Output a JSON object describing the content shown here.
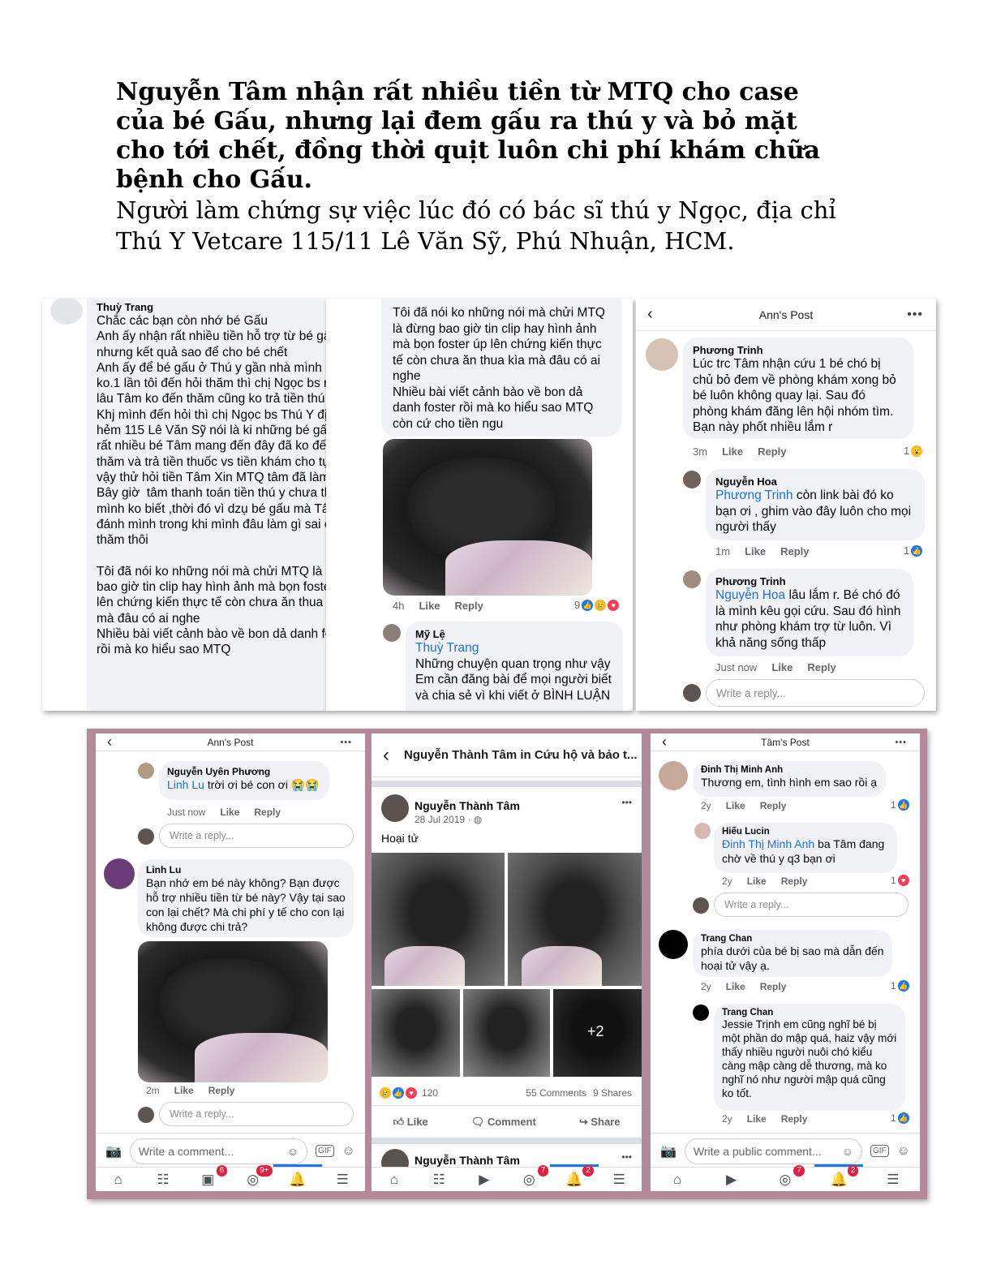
{
  "heading": "Nguyễn Tâm nhận rất nhiều tiền từ MTQ cho case của bé Gấu, nhưng lại đem gấu ra thú y và bỏ mặt cho tới chết, đồng thời quịt luôn chi phí khám chữa bệnh cho Gấu.",
  "subheading": "Người làm chứng sự việc lúc đó có bác sĩ thú y Ngọc, địa chỉ Thú Y Vetcare 115/11 Lê Văn Sỹ, Phú Nhuận, HCM.",
  "shot1": {
    "name": "Thuỳ Trang",
    "text": "Chắc các bạn còn nhớ bé Gấu\nAnh ấy nhận rất nhiều tiền hỗ trợ từ bé gấu nhưng kết quả sao để cho bé chết\nAnh ấy để bé gấu ở Thú y gần nhà mình rất lâu ko.1 lần tôi đến hỏi thăm thì chị Ngọc bs nói  từ lâu Tâm ko đến thăm cũng ko trả tiền thú y\nKhj mình đến hỏi thì chị Ngọc bs Thú Y địa chỉ hẻm 115 Lê Văn Sỹ nói là ki những bé gấu và rất nhiều bé Tâm mang đến đây đã ko đến thăm và trả tiền thuốc vs tiền khám cho tụi nhỏ vậy thử hỏi tiền Tâm Xin MTQ tâm đã làm  gì\nBây giờ  tâm thanh toán tiền thú y chưa thì mình ko biết ,thời đó vì dzụ bé gấu mà Tâm đòi đánh mình trong khi mình đâu làm gì sai chỉ hỏi thăm thôi\n\nTôi đã nói ko những nói mà chửi MTQ là đừng bao giờ tin clip hay hình ảnh mà bọn foster úp lên chứng kiến thực tế còn chưa ăn thua kìa mà đâu có ai nghe\nNhiều bài viết cảnh bào về bon dả danh foster rồi mà ko hiểu sao MTQ"
  },
  "shot2": {
    "text": "Tôi đã nói ko những nói mà chửi MTQ là đừng bao giờ tin clip hay hình ảnh mà bọn foster úp lên chứng kiến thực tế còn chưa ăn thua kìa mà đâu có ai nghe\nNhiều bài viết cảnh bào về bon dả danh foster rồi mà ko hiểu sao MTQ còn cứ cho tiền ngu",
    "time": "4h",
    "like": "Like",
    "reply": "Reply",
    "reactions": "9",
    "reply_name": "Mỹ Lệ",
    "reply_mention": "Thuỳ Trang",
    "reply_text": "Những chuyện quan trọng như vậy Em cần đăng bài để mọi người biết và chia sẻ vì khi viết ở BÌNH LUẬN"
  },
  "shot3": {
    "title": "Ann's Post",
    "c1": {
      "name": "Phương Trinh",
      "text": "Lúc trc Tâm nhận cứu 1 bé chó bị chủ bỏ đem về phòng khám xong bỏ bé luôn không quay lại. Sau đó phòng khám đăng lên hội nhóm tìm. Bạn này phốt nhiều lắm r",
      "time": "3m",
      "count": "1"
    },
    "c2": {
      "name": "Nguyễn Hoa",
      "mention": "Phương Trinh",
      "text": " còn link bài đó ko bạn ơi , ghim vào đây luôn cho mọi người thấy",
      "time": "1m",
      "count": "1"
    },
    "c3": {
      "name": "Phương Trinh",
      "mention": "Nguyễn Hoa",
      "text": " lâu lắm r. Bé chó đó là mình kêu gọi cứu. Sau đó hình như phòng khám trợ từ luôn. Vì khả năng sống thấp",
      "time": "Just now"
    },
    "like": "Like",
    "reply": "Reply",
    "write_reply": "Write a reply..."
  },
  "shot4": {
    "title": "Ann's Post",
    "c1": {
      "name": "Nguyễn Uyên Phương",
      "mention": "Linh Lu",
      "text": " trời ơi bé con ơi 😭😭",
      "time": "Just now"
    },
    "c2": {
      "name": "Linh Lu",
      "text": "Bạn nhớ em bé này không? Bạn được hỗ trợ nhiều tiền từ bé này? Vậy tại sao con lại chết? Mà chi phí y tế cho con lại không được chi trả?",
      "time": "2m"
    },
    "like": "Like",
    "reply": "Reply",
    "write_reply": "Write a reply...",
    "write_comment": "Write a comment...",
    "badges": [
      "6",
      "9+"
    ]
  },
  "shot5": {
    "title": "Nguyễn Thành Tâm in Cứu hộ và bảo t...",
    "author": "Nguyễn Thành Tâm",
    "date": "28 Jul 2019 · ",
    "post_text": "Hoại tử",
    "more_photos": "+2",
    "reaction_count": "120",
    "comments": "55 Comments",
    "shares": "9 Shares",
    "like": "Like",
    "comment": "Comment",
    "share": "Share",
    "next_author": "Nguyễn Thành Tâm",
    "badges": [
      "7",
      "2"
    ]
  },
  "shot6": {
    "title": "Tâm's Post",
    "c1": {
      "name": "Đinh Thị Minh Anh",
      "text": "Thương em, tình hình em sao rồi ạ",
      "time": "2y",
      "count": "1"
    },
    "c2": {
      "name": "Hiếu Lucin",
      "mention": "Đinh Thị Minh Anh",
      "text": " ba Tâm đang chờ về thú y q3 bạn ơi",
      "time": "2y",
      "count": "1"
    },
    "c3": {
      "name": "Trang Chan",
      "text": "phía dưới của bé bị sao mà dẫn đến hoại tử vậy ạ.",
      "time": "2y",
      "count": "1"
    },
    "c4": {
      "name": "Trang Chan",
      "text": "Jessie Trịnh em cũng nghĩ bé bị một phần do mập quá, haiz vậy mới thấy nhiều người nuôi chó kiểu càng mập càng dễ thương, mà ko nghĩ nó như người mập quá cũng ko tốt.",
      "time": "2y",
      "count": "1"
    },
    "like": "Like",
    "reply": "Reply",
    "write_reply": "Write a reply...",
    "write_comment": "Write a public comment...",
    "badges": [
      "7",
      "2"
    ]
  },
  "colors": {
    "accent": "#1877f2",
    "frame": "#b48999",
    "bubble": "#f0f2f5"
  },
  "icons": [
    "back-chevron-icon",
    "more-dots-icon",
    "camera-icon",
    "gif-icon",
    "sticker-icon",
    "home-icon",
    "friends-icon",
    "video-icon",
    "groups-icon",
    "bell-icon",
    "menu-icon",
    "globe-icon",
    "like-icon",
    "comment-icon",
    "share-icon"
  ]
}
